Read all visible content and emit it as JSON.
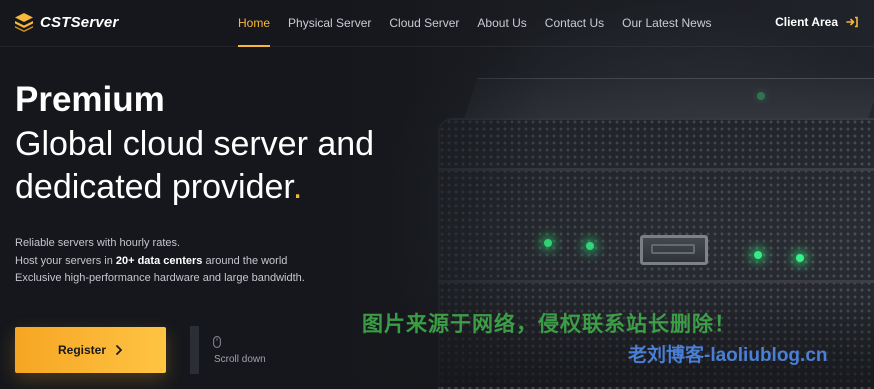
{
  "brand": {
    "name": "CSTServer",
    "accent": "#f6b73c"
  },
  "nav": {
    "items": [
      {
        "label": "Home",
        "active": true
      },
      {
        "label": "Physical Server",
        "active": false
      },
      {
        "label": "Cloud Server",
        "active": false
      },
      {
        "label": "About Us",
        "active": false
      },
      {
        "label": "Contact Us",
        "active": false
      },
      {
        "label": "Our Latest News",
        "active": false
      }
    ],
    "client_area": "Client Area",
    "client_icon": "login-icon"
  },
  "hero": {
    "kicker": "Premium",
    "line1": "Global cloud server and",
    "line2": "dedicated provider",
    "line2_dot": ".",
    "desc_line1": "Reliable servers with hourly rates.",
    "desc_line2_pre": "Host your servers in ",
    "desc_line2_bold": "20+ data centers",
    "desc_line2_post": " around the world",
    "desc_line3": "Exclusive high-performance hardware and large bandwidth."
  },
  "cta": {
    "register_label": "Register",
    "register_icon": "chevron-right-icon",
    "scroll_label": "Scroll down",
    "scroll_icon": "mouse-icon"
  },
  "watermark": {
    "line1": "图片来源于网络，侵权联系站长删除！",
    "line2": "老刘博客-laoliublog.cn"
  }
}
